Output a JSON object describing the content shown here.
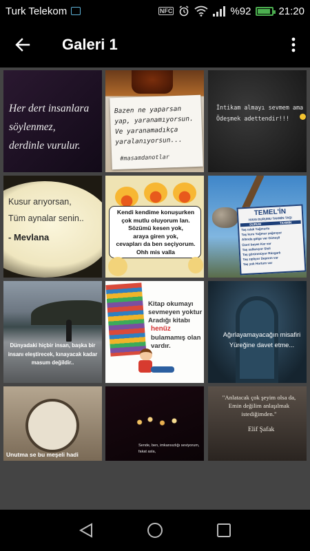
{
  "status": {
    "carrier": "Turk Telekom",
    "nfc": "NFC",
    "battery_text": "%92",
    "battery_level": 0.92,
    "time": "21:20"
  },
  "app_bar": {
    "title": "Galeri 1"
  },
  "tiles": [
    {
      "text": "Her dert insanlara\nsöylenmez,\nderdinle vurulur."
    },
    {
      "text": "Bazen ne yaparsan\nyap, yaranamıyorsun.\nVe yaranamadıkça\nyaralanıyorsun...",
      "tag": "#masamdanotlar"
    },
    {
      "text": "İntikam almayı sevmem ama\nÖdeşmek adettendir!!!"
    },
    {
      "text": "Kusur arıyorsan,\nTüm aynalar senin..",
      "author": "- Mevlana"
    },
    {
      "text": "Kendi kendime konuşurken\nçok mutlu oluyorum lan.\nSözümü kesen yok,\naraya giren yok,\ncevapları da ben seçiyorum.\nOhh mis valla"
    },
    {
      "sign_title": "TEMEL'İN",
      "sign_sub": "HAVA DURUMU TAHMİN TAŞI",
      "sign_col1": "DURUM",
      "sign_col2": "TAHMİN",
      "sign_rows": [
        "Taş ıslak  Yağmurlu",
        "Taş kuru  Yağmur yağmıyor",
        "Altında gölge var  Güneşli",
        "Üzeri beyaz  Kar var",
        "Taş sallanıyor  Sisli",
        "Taş görünmüyor  Rüzgarlı",
        "Taş zıplıyor  Deprem var",
        "Taş yok  Hortum var"
      ]
    },
    {
      "text": "Dünyadaki hiçbir insan, başka bir\ninsanı eleştirecek, kınayacak kadar\nmasum değildir.."
    },
    {
      "text": "Kitap okumayı\nsevmeyen yoktur\nAradığı kitabı",
      "highlight": "henüz",
      "text2": "bulamamış olan\nvardır."
    },
    {
      "text": "Ağırlayamayacağın misafiri\nYüreğine davet etme..."
    },
    {
      "text": "Unutma se bu meşeli hadi"
    },
    {
      "text": "Sende, ben, imkansızlığı seviyorum,\nfakat asla,"
    },
    {
      "text": "\"Anlatacak çok şeyim olsa da,\nEmin değilim anlaşılmak\nistediğimden.\"",
      "author": "Elif Şafak"
    }
  ],
  "colors": {
    "status_bg": "#000000",
    "content_bg": "#444444",
    "battery": "#4caf50",
    "highlight_red": "#d32f2f"
  }
}
